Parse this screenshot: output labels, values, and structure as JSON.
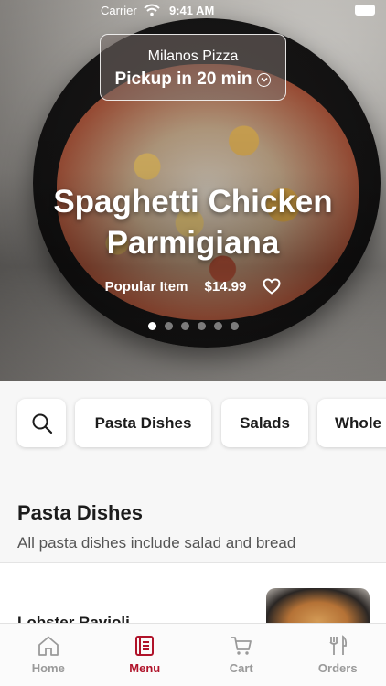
{
  "status_bar": {
    "carrier": "Carrier",
    "time": "9:41 AM"
  },
  "store": {
    "name": "Milanos Pizza",
    "pickup": "Pickup in 20 min"
  },
  "featured": {
    "title_line1": "Spaghetti Chicken",
    "title_line2": "Parmigiana",
    "tag": "Popular Item",
    "price": "$14.99",
    "carousel_count": 6,
    "carousel_active": 0
  },
  "categories": {
    "items": [
      "Pasta Dishes",
      "Salads",
      "Whole"
    ]
  },
  "section": {
    "title": "Pasta Dishes",
    "subtitle": "All pasta dishes include salad and bread"
  },
  "menu_items": [
    {
      "name": "Lobster Ravioli"
    }
  ],
  "tabbar": {
    "tabs": [
      {
        "label": "Home",
        "icon": "home-icon",
        "active": false
      },
      {
        "label": "Menu",
        "icon": "menu-icon",
        "active": true
      },
      {
        "label": "Cart",
        "icon": "cart-icon",
        "active": false
      },
      {
        "label": "Orders",
        "icon": "orders-icon",
        "active": false
      }
    ]
  },
  "colors": {
    "accent": "#b0132a",
    "inactive": "#9a9a9a"
  }
}
